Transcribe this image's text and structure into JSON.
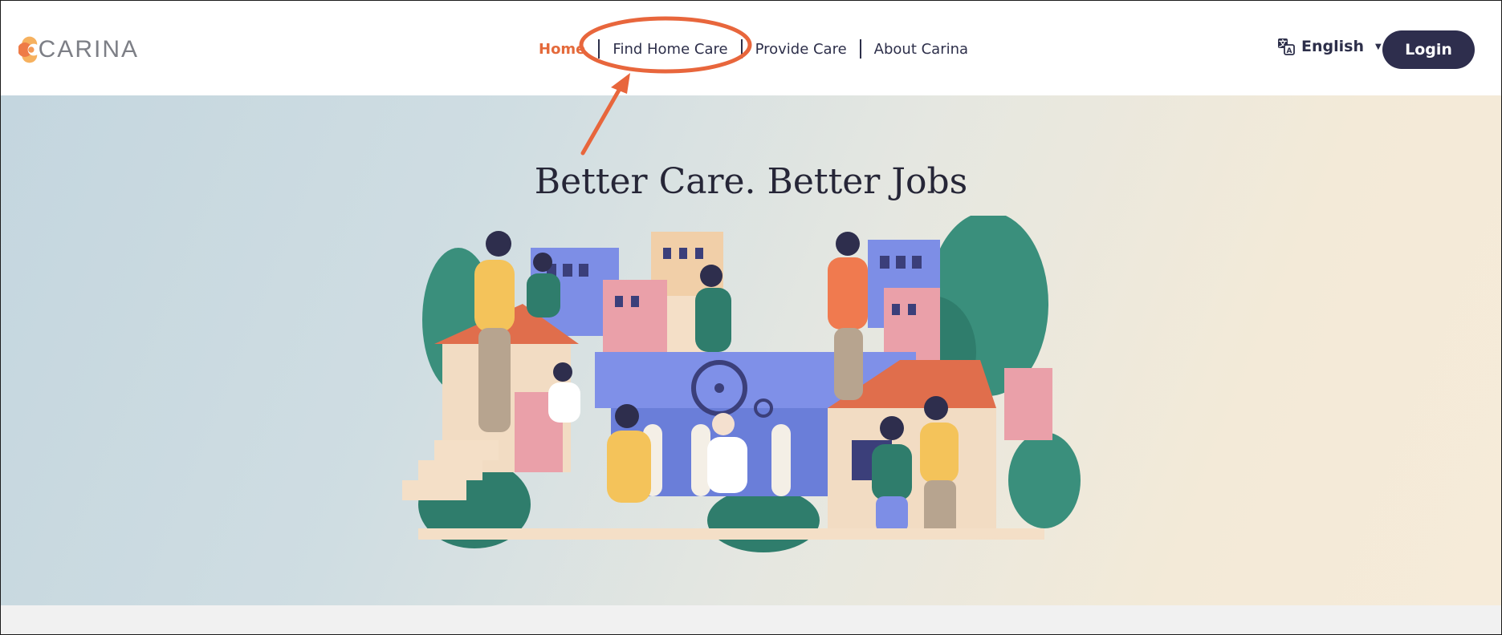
{
  "header": {
    "logo_text": "CARINA",
    "nav": [
      {
        "label": "Home",
        "active": true
      },
      {
        "label": "Find Home Care",
        "active": false
      },
      {
        "label": "Provide Care",
        "active": false
      },
      {
        "label": "About Carina",
        "active": false
      }
    ],
    "language": {
      "label": "English",
      "icon": "translate-icon"
    },
    "login_label": "Login"
  },
  "hero": {
    "title": "Better Care. Better Jobs",
    "illustration": "community-care-illustration"
  },
  "colors": {
    "accent": "#e46a3b",
    "nav_text": "#2d2f4a",
    "login_bg": "#2e2e4d",
    "annotation": "#e8663c"
  }
}
